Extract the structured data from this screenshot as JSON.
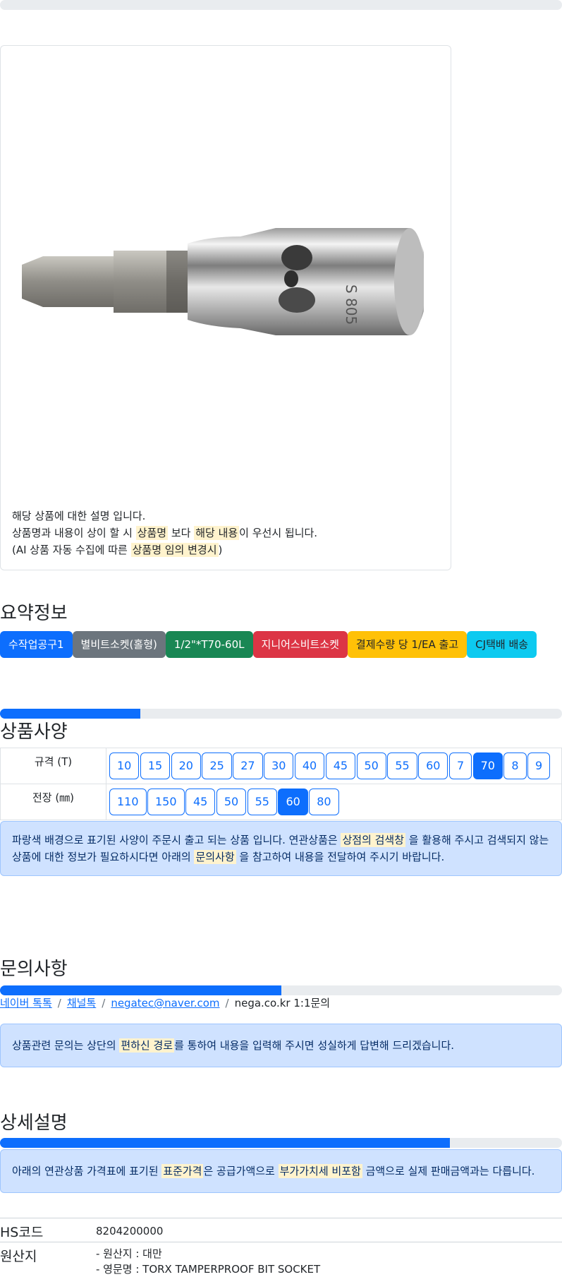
{
  "top_progress": 1.0,
  "product": {
    "note_line1": "해당 상품에 대한 설명 입니다.",
    "note_line2_a": "상품명과 내용이 상이 할 시 ",
    "note_line2_hl1": "상품명",
    "note_line2_b": " 보다 ",
    "note_line2_hl2": "해당 내용",
    "note_line2_c": "이 우선시 됩니다.",
    "note_line3_a": "(AI 상품 자동 수집에 따른 ",
    "note_line3_hl": "상품명 임의 변경시",
    "note_line3_b": ")"
  },
  "summary": {
    "title": "요약정보",
    "badges": [
      "수작업공구1",
      "별비트소켓(홀형)",
      "1/2\"*T70-60L",
      "지니어스비트소켓",
      "결제수량 당 1/EA 출고",
      "CJ택배 배송"
    ]
  },
  "spec": {
    "progress": 0.25,
    "title": "상품사양",
    "rows": [
      {
        "label": "규격 (T)",
        "options": [
          "10",
          "15",
          "20",
          "25",
          "27",
          "30",
          "40",
          "45",
          "50",
          "55",
          "60",
          "7",
          "70",
          "8",
          "9"
        ],
        "selected": "70"
      },
      {
        "label": "전장 (㎜)",
        "options": [
          "110",
          "150",
          "45",
          "50",
          "55",
          "60",
          "80"
        ],
        "selected": "60"
      }
    ],
    "alert_a": "파랑색 배경으로 표기된 사양이 주문시 출고 되는 상품 입니다. 연관상품은 ",
    "alert_hl1": "상점의 검색창",
    "alert_b": " 을 활용해 주시고 검색되지 않는 상품에 대한 정보가 필요하시다면 아래의 ",
    "alert_hl2": "문의사항",
    "alert_c": " 을 참고하여 내용을 전달하여 주시기 바랍니다."
  },
  "inquiry": {
    "title": "문의사항",
    "progress": 0.5,
    "links": [
      "네이버 톡톡",
      "채널톡",
      "negatec@naver.com"
    ],
    "plain": "nega.co.kr 1:1문의",
    "alert_a": "상품관련 문의는 상단의 ",
    "alert_hl": "편하신 경로",
    "alert_b": "를 통하여 내용을 입력해 주시면 성실하게 답변해 드리겠습니다."
  },
  "detail": {
    "title": "상세설명",
    "progress": 0.8,
    "alert_a": "아래의 연관상품 가격표에 표기된 ",
    "alert_hl1": "표준가격",
    "alert_b": "은 공급가액으로 ",
    "alert_hl2": "부가가치세 비포함",
    "alert_c": " 금액으로 실제 판매금액과는 다릅니다.",
    "hs_key": "HS코드",
    "hs_val": "8204200000",
    "origin_key": "원산지",
    "origin_val1": "- 원산지 : 대만",
    "origin_val2": "- 영문명 : TORX TAMPERPROOF BIT SOCKET"
  }
}
